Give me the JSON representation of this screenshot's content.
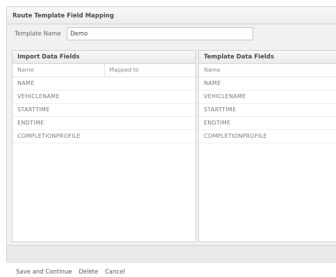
{
  "dialog": {
    "title": "Route Template Field Mapping"
  },
  "template_name": {
    "label": "Template Name",
    "value": "Demo"
  },
  "import_panel": {
    "header": "Import Data Fields",
    "columns": [
      "Name",
      "Mapped to"
    ],
    "rows": [
      "NAME",
      "VEHICLENAME",
      "STARTTIME",
      "ENDTIME",
      "COMPLETIONPROFILE"
    ]
  },
  "template_panel": {
    "header": "Template Data Fields",
    "columns": [
      "Name"
    ],
    "rows": [
      "NAME",
      "VEHICLENAME",
      "STARTTIME",
      "ENDTIME",
      "COMPLETIONPROFILE"
    ]
  },
  "actions": {
    "save": "Save and Continue",
    "delete": "Delete",
    "cancel": "Cancel"
  }
}
